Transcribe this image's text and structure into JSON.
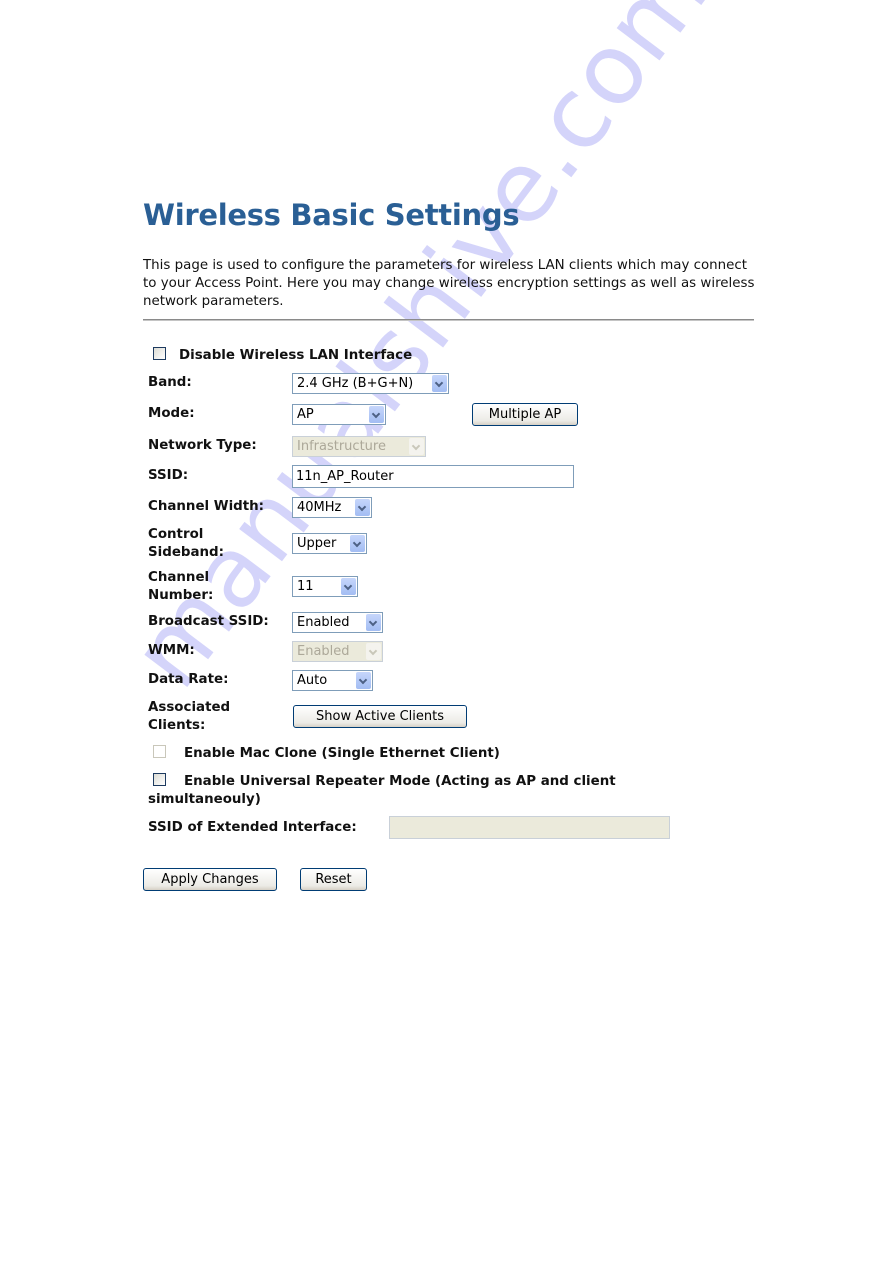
{
  "page": {
    "title": "Wireless Basic Settings",
    "description": "This page is used to configure the parameters for wireless LAN clients which may connect to your Access Point. Here you may change wireless encryption settings as well as wireless network parameters."
  },
  "form": {
    "disable_wlan": {
      "label": "Disable Wireless LAN Interface",
      "checked": false
    },
    "band": {
      "label": "Band:",
      "value": "2.4 GHz (B+G+N)"
    },
    "mode": {
      "label": "Mode:",
      "value": "AP"
    },
    "multiple_ap_button": "Multiple AP",
    "network_type": {
      "label": "Network Type:",
      "value": "Infrastructure",
      "disabled": true
    },
    "ssid": {
      "label": "SSID:",
      "value": "11n_AP_Router"
    },
    "channel_width": {
      "label": "Channel Width:",
      "value": "40MHz"
    },
    "control_sideband": {
      "label_line1": "Control",
      "label_line2": "Sideband:",
      "value": "Upper"
    },
    "channel_number": {
      "label_line1": "Channel",
      "label_line2": "Number:",
      "value": "11"
    },
    "broadcast_ssid": {
      "label": "Broadcast SSID:",
      "value": "Enabled"
    },
    "wmm": {
      "label": "WMM:",
      "value": "Enabled",
      "disabled": true
    },
    "data_rate": {
      "label": "Data Rate:",
      "value": "Auto"
    },
    "associated_clients": {
      "label_line1": "Associated",
      "label_line2": "Clients:",
      "button": "Show Active Clients"
    },
    "mac_clone": {
      "label": "Enable Mac Clone (Single Ethernet Client)",
      "checked": false,
      "disabled": true
    },
    "universal_repeater": {
      "label_line1": "Enable Universal Repeater Mode (Acting as AP and client",
      "label_line2": "simultaneouly)",
      "checked": false
    },
    "extended_ssid": {
      "label": "SSID of Extended Interface:",
      "value": "",
      "disabled": true
    }
  },
  "actions": {
    "apply": "Apply Changes",
    "reset": "Reset"
  },
  "watermark": "manualshive.com",
  "colors": {
    "title": "#2a5f95",
    "watermark": "#a0a0f5"
  }
}
